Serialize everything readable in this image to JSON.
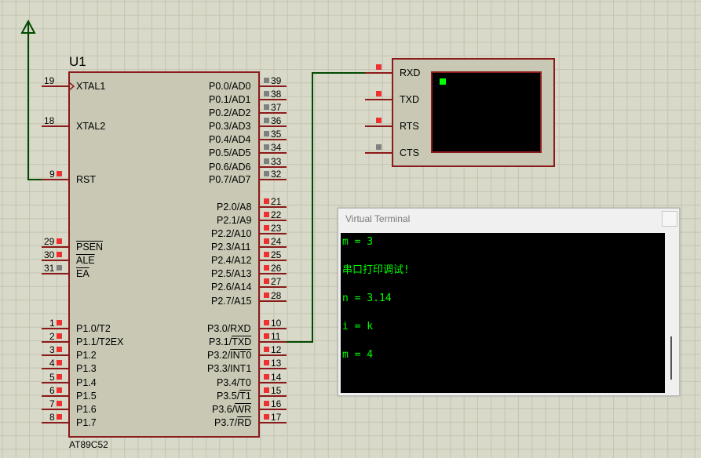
{
  "chip": {
    "ref": "U1",
    "part": "AT89C52",
    "left_pins": [
      {
        "num": "19",
        "label": "XTAL1",
        "overline": false,
        "clock": true
      },
      {
        "num": "18",
        "label": "XTAL2",
        "overline": false
      },
      {
        "num": "9",
        "label": "RST",
        "overline": false
      },
      {
        "num": "29",
        "label": "PSEN",
        "overline": true
      },
      {
        "num": "30",
        "label": "ALE",
        "overline": true
      },
      {
        "num": "31",
        "label": "EA",
        "overline": true
      },
      {
        "num": "1",
        "label": "P1.0/T2"
      },
      {
        "num": "2",
        "label": "P1.1/T2EX"
      },
      {
        "num": "3",
        "label": "P1.2"
      },
      {
        "num": "4",
        "label": "P1.3"
      },
      {
        "num": "5",
        "label": "P1.4"
      },
      {
        "num": "6",
        "label": "P1.5"
      },
      {
        "num": "7",
        "label": "P1.6"
      },
      {
        "num": "8",
        "label": "P1.7"
      }
    ],
    "right_pins": [
      {
        "num": "39",
        "label": "P0.0/AD0"
      },
      {
        "num": "38",
        "label": "P0.1/AD1"
      },
      {
        "num": "37",
        "label": "P0.2/AD2"
      },
      {
        "num": "36",
        "label": "P0.3/AD3"
      },
      {
        "num": "35",
        "label": "P0.4/AD4"
      },
      {
        "num": "34",
        "label": "P0.5/AD5"
      },
      {
        "num": "33",
        "label": "P0.6/AD6"
      },
      {
        "num": "32",
        "label": "P0.7/AD7"
      },
      {
        "num": "21",
        "label": "P2.0/A8"
      },
      {
        "num": "22",
        "label": "P2.1/A9"
      },
      {
        "num": "23",
        "label": "P2.2/A10"
      },
      {
        "num": "24",
        "label": "P2.3/A11"
      },
      {
        "num": "25",
        "label": "P2.4/A12"
      },
      {
        "num": "26",
        "label": "P2.5/A13"
      },
      {
        "num": "27",
        "label": "P2.6/A14"
      },
      {
        "num": "28",
        "label": "P2.7/A15"
      },
      {
        "num": "10",
        "label": "P3.0/RXD"
      },
      {
        "num": "11",
        "label": "P3.1/",
        "suffix": "TXD"
      },
      {
        "num": "12",
        "label": "P3.2/",
        "suffix": "INT0"
      },
      {
        "num": "13",
        "label": "P3.3/INT1"
      },
      {
        "num": "14",
        "label": "P3.4/T0"
      },
      {
        "num": "15",
        "label": "P3.5/",
        "suffix": "T1"
      },
      {
        "num": "16",
        "label": "P3.6/",
        "suffix": "WR"
      },
      {
        "num": "17",
        "label": "P3.7/",
        "suffix": "RD"
      }
    ]
  },
  "terminal_component": {
    "pins": [
      "RXD",
      "TXD",
      "RTS",
      "CTS"
    ]
  },
  "virtual_terminal": {
    "title": "Virtual Terminal",
    "lines": [
      "m = 3",
      "串口打印调试!",
      "n = 3.14",
      "i = k",
      "m = 4"
    ]
  },
  "colors": {
    "background": "#d9d9c9",
    "component_border": "#8b1a1a",
    "component_fill": "#c8c8b4",
    "wire": "#004a00",
    "pin_active": "#ee3030",
    "pin_inactive": "#808080",
    "terminal_text": "#00ff00"
  }
}
